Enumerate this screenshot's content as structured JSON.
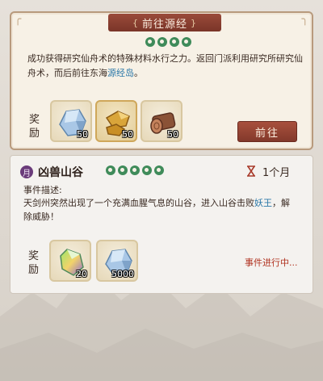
{
  "quest": {
    "title": "前往源经",
    "description_main": "成功获得研究仙舟术的特殊材料水行之力。返回门派利用研究所研究仙舟术，而后前往东海",
    "description_link": "源经岛",
    "description_end": "。",
    "reward_label": "奖励",
    "rewards": [
      {
        "icon": "blue-crystal-icon",
        "count": "50"
      },
      {
        "icon": "gold-ore-icon",
        "count": "50"
      },
      {
        "icon": "wood-log-icon",
        "count": "50"
      }
    ],
    "go_button": "前往"
  },
  "event": {
    "badge": "月",
    "title": "凶兽山谷",
    "duration": "1个月",
    "desc_label": "事件描述:",
    "description_main": "天剑州突然出现了一个充满血腥气息的山谷，进入山谷击败",
    "description_link": "妖王",
    "description_end": "，解除威胁！",
    "reward_label": "奖励",
    "rewards": [
      {
        "icon": "rainbow-crystal-icon",
        "count": "20"
      },
      {
        "icon": "blue-crystal-icon",
        "count": "5000"
      }
    ],
    "status": "事件进行中..."
  },
  "colors": {
    "accent_red": "#8a3c2e",
    "link_blue": "#2b78a8",
    "swirl_green": "#3f8b5a",
    "status_red": "#b0321f"
  }
}
